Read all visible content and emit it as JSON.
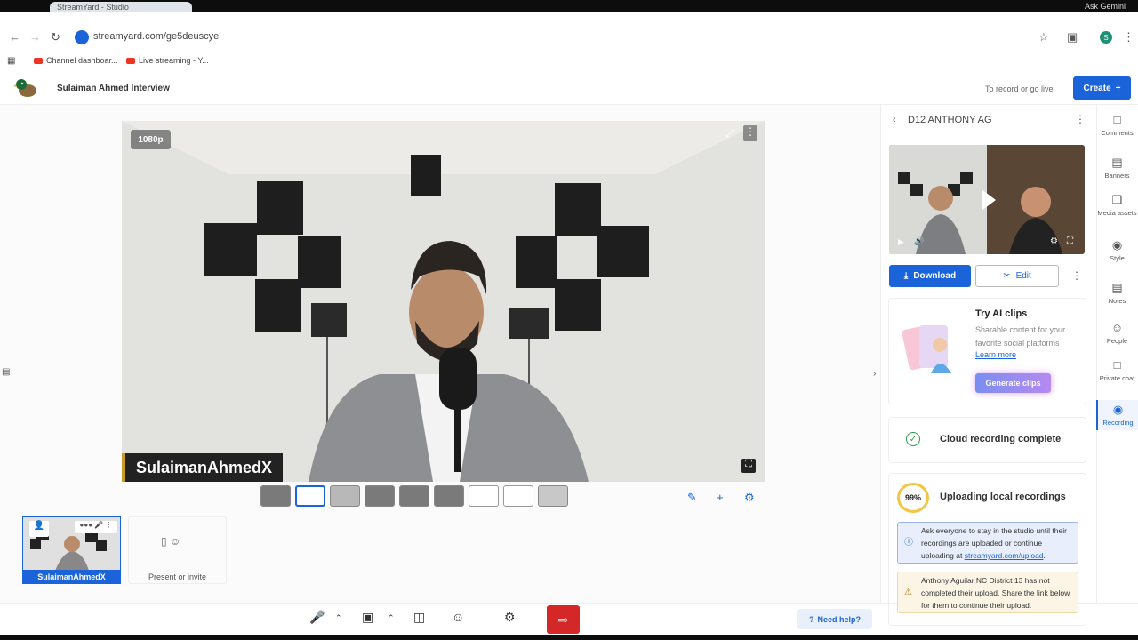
{
  "browser": {
    "tab_title": "StreamYard - Studio",
    "url": "streamyard.com/ge5deuscye",
    "gemini_label": "Ask Gemini",
    "profile_initial": "S",
    "bookmarks": [
      "Channel dashboar...",
      "Live streaming - Y..."
    ]
  },
  "header": {
    "studio_name": "Sulaiman Ahmed Interview",
    "record_hint": "To record or go live",
    "create_label": "Create",
    "create_icon": "plus-icon"
  },
  "stage": {
    "resolution": "1080p",
    "participant_name": "SulaimanAhmedX",
    "present_label": "Present or invite"
  },
  "panel": {
    "title": "D12 ANTHONY AG",
    "download_label": "Download",
    "edit_label": "Edit",
    "ai_clips": {
      "title": "Try AI clips",
      "description": "Sharable content for your favorite social platforms",
      "learn_more": "Learn more",
      "generate_label": "Generate clips"
    },
    "cloud_status": "Cloud recording complete",
    "upload": {
      "percent": "99%",
      "title": "Uploading local recordings",
      "info_text": "Ask everyone to stay in the studio until their recordings are uploaded or continue uploading at",
      "info_link": "streamyard.com/upload",
      "warning_text": "Anthony Aguilar NC District 13 has not completed their upload. Share the link below for them to continue their upload."
    }
  },
  "rail": {
    "items": [
      {
        "label": "Comments",
        "icon": "comment-icon"
      },
      {
        "label": "Banners",
        "icon": "banner-icon"
      },
      {
        "label": "Media assets",
        "icon": "media-icon"
      },
      {
        "label": "Style",
        "icon": "palette-icon"
      },
      {
        "label": "Notes",
        "icon": "notes-icon"
      },
      {
        "label": "People",
        "icon": "people-icon"
      },
      {
        "label": "Private chat",
        "icon": "chat-icon"
      },
      {
        "label": "Recording",
        "icon": "record-icon",
        "active": true
      }
    ]
  },
  "footer": {
    "help_label": "Need help?"
  },
  "colors": {
    "accent": "#1a63d8",
    "leave": "#d42828",
    "banner_edge": "#c79b26"
  }
}
